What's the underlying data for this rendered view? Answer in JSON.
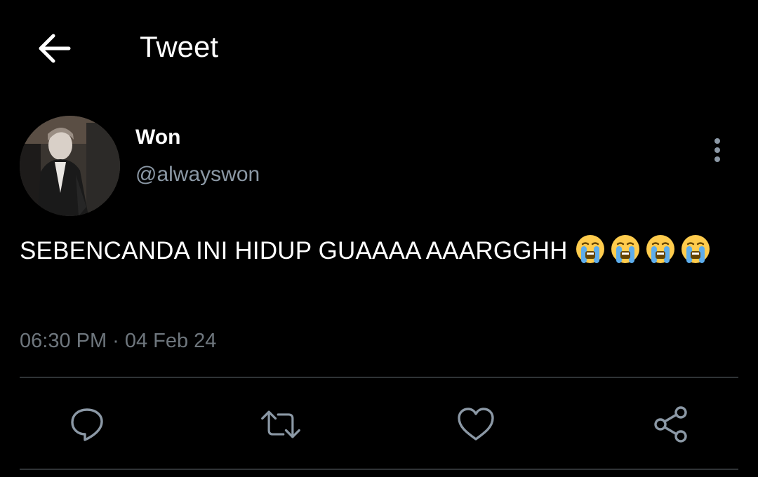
{
  "header": {
    "title": "Tweet",
    "back_icon": "arrow-left-icon"
  },
  "tweet": {
    "author_name": "Won",
    "author_handle": "@alwayswon",
    "text": "SEBENCANDA INI HIDUP GUAAAA AAARGGHH",
    "emojis": [
      "loudly-crying-face",
      "loudly-crying-face",
      "loudly-crying-face",
      "loudly-crying-face"
    ],
    "time": "06:30 PM",
    "separator": "·",
    "date": "04 Feb 24"
  },
  "actions": {
    "reply_icon": "reply-icon",
    "retweet_icon": "retweet-icon",
    "like_icon": "heart-icon",
    "share_icon": "share-icon"
  },
  "colors": {
    "background": "#000000",
    "primary_text": "#ffffff",
    "secondary_text": "#8b98a5",
    "meta_text": "#6e767d",
    "divider": "#2f3336"
  }
}
